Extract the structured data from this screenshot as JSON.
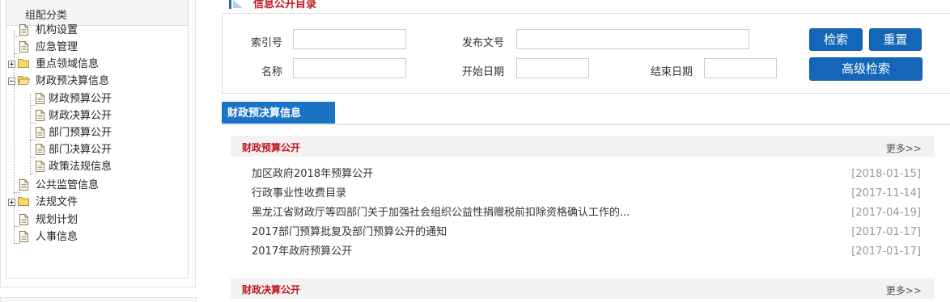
{
  "left_panel": {
    "title": "组配分类",
    "items": [
      {
        "label": "机构设置",
        "icon": "document-icon"
      },
      {
        "label": "应急管理",
        "icon": "document-icon"
      },
      {
        "label": "重点领域信息",
        "icon": "folder-icon",
        "toggle": "plus"
      },
      {
        "label": "财政预决算信息",
        "icon": "folder-open-icon",
        "toggle": "minus"
      },
      {
        "label": "财政预算公开",
        "icon": "document-icon"
      },
      {
        "label": "财政决算公开",
        "icon": "document-icon"
      },
      {
        "label": "部门预算公开",
        "icon": "document-icon"
      },
      {
        "label": "部门决算公开",
        "icon": "document-icon"
      },
      {
        "label": "政策法规信息",
        "icon": "document-icon"
      },
      {
        "label": "公共监管信息",
        "icon": "document-icon"
      },
      {
        "label": "法规文件",
        "icon": "folder-icon",
        "toggle": "plus"
      },
      {
        "label": "规划计划",
        "icon": "document-icon"
      },
      {
        "label": "人事信息",
        "icon": "document-icon"
      }
    ]
  },
  "directory": {
    "title": "信息公开目录"
  },
  "search": {
    "index_label": "索引号",
    "doc_no_label": "发布文号",
    "name_label": "名称",
    "start_date_label": "开始日期",
    "end_date_label": "结束日期",
    "index_value": "",
    "doc_no_value": "",
    "name_value": "",
    "start_date_value": "",
    "end_date_value": "",
    "search_button": "检索",
    "reset_button": "重置",
    "advanced_button": "高级检索"
  },
  "section": {
    "tab_label": "财政预决算信息",
    "blocks": [
      {
        "title": "财政预算公开",
        "more": "更多>>",
        "items": [
          {
            "title": "加区政府2018年预算公开",
            "date": "[2018-01-15]"
          },
          {
            "title": "行政事业性收费目录",
            "date": "[2017-11-14]"
          },
          {
            "title": "黑龙江省财政厅等四部门关于加强社会组织公益性捐赠税前扣除资格确认工作的...",
            "date": "[2017-04-19]"
          },
          {
            "title": "2017部门预算批复及部门预算公开的通知",
            "date": "[2017-01-17]"
          },
          {
            "title": "2017年政府预算公开",
            "date": "[2017-01-17]"
          }
        ]
      },
      {
        "title": "财政决算公开",
        "more": "更多>>",
        "items": []
      }
    ]
  },
  "colors": {
    "accent_blue": "#1467b8",
    "title_red": "#c0171d",
    "date_gray": "#999999"
  }
}
